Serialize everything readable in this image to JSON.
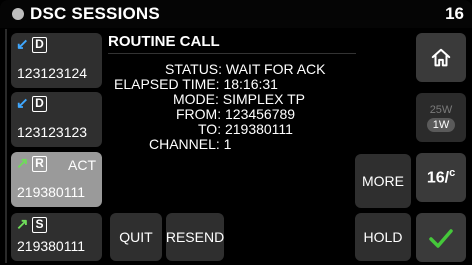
{
  "header": {
    "title": "DSC SESSIONS",
    "channel": "16"
  },
  "sessions": [
    {
      "direction_icon": "incoming-arrow-icon",
      "glyph": "↙",
      "type": "D",
      "state": "",
      "number": "123123124",
      "active": false
    },
    {
      "direction_icon": "incoming-arrow-icon",
      "glyph": "↙",
      "type": "D",
      "state": "",
      "number": "123123123",
      "active": false
    },
    {
      "direction_icon": "outgoing-arrow-icon",
      "glyph": "↗",
      "type": "R",
      "state": "ACT",
      "number": "219380111",
      "active": true
    },
    {
      "direction_icon": "outgoing-arrow-icon",
      "glyph": "↗",
      "type": "S",
      "state": "",
      "number": "219380111",
      "active": false
    }
  ],
  "call": {
    "title": "ROUTINE CALL",
    "status": "STATUS: WAIT FOR ACK",
    "elapsed": "ELAPSED TIME: 18:16:31",
    "mode": "MODE: SIMPLEX TP",
    "from": "FROM: 123456789",
    "to": "TO: 219380111",
    "channel": "CHANNEL: 1"
  },
  "buttons": {
    "quit": "QUIT",
    "resend": "RESEND",
    "more": "MORE",
    "hold": "HOLD"
  },
  "right_panel": {
    "home_icon": "home-icon",
    "power_high": "25W",
    "power_low": "1W",
    "units_main": "16",
    "units_sub": "c",
    "confirm_icon": "checkmark-icon"
  },
  "colors": {
    "incoming_arrow": "#3fa8ff",
    "outgoing_arrow": "#6fdc5a",
    "checkmark": "#45c83a",
    "active_session": "#9a9a9a"
  }
}
